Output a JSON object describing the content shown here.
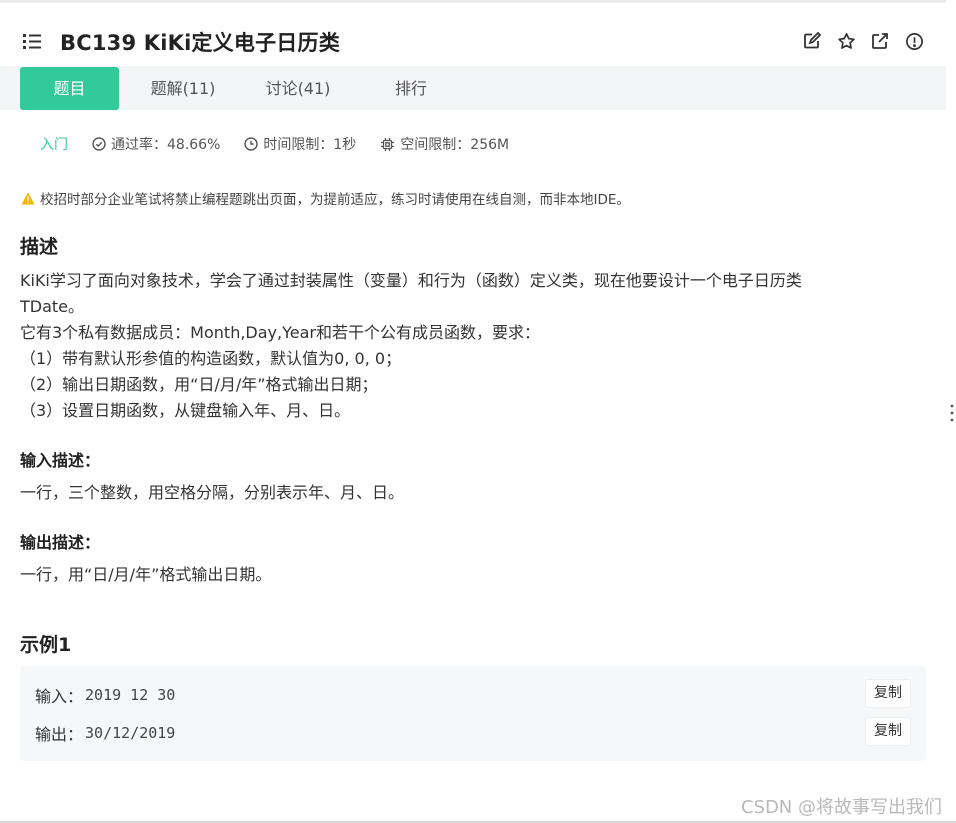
{
  "header": {
    "title": "BC139  KiKi定义电子日历类",
    "icons": [
      "list-icon",
      "edit-icon",
      "star-icon",
      "share-icon",
      "report-icon"
    ]
  },
  "tabs": [
    {
      "label": "题目",
      "active": true
    },
    {
      "label": "题解(11)",
      "active": false
    },
    {
      "label": "讨论(41)",
      "active": false
    },
    {
      "label": "排行",
      "active": false
    }
  ],
  "meta": {
    "level": "入门",
    "pass_rate": "通过率：48.66%",
    "time_limit": "时间限制：1秒",
    "memory_limit": "空间限制：256M"
  },
  "notice": "校招时部分企业笔试将禁止编程题跳出页面，为提前适应，练习时请使用在线自测，而非本地IDE。",
  "description": {
    "heading": "描述",
    "lines": [
      "KiKi学习了面向对象技术，学会了通过封装属性（变量）和行为（函数）定义类，现在他要设计一个电子日历类",
      "TDate。",
      "它有3个私有数据成员：Month,Day,Year和若干个公有成员函数，要求：",
      "（1）带有默认形参值的构造函数，默认值为0, 0, 0；",
      "（2）输出日期函数，用“日/月/年”格式输出日期；",
      "（3）设置日期函数，从键盘输入年、月、日。"
    ]
  },
  "input_desc": {
    "heading": "输入描述：",
    "text": "一行，三个整数，用空格分隔，分别表示年、月、日。"
  },
  "output_desc": {
    "heading": "输出描述：",
    "text": "一行，用“日/月/年”格式输出日期。"
  },
  "example": {
    "heading": "示例1",
    "input_label": "输入：",
    "input_value": "2019 12 30",
    "output_label": "输出：",
    "output_value": "30/12/2019",
    "copy_label": "复制"
  },
  "watermark": "CSDN @将故事写出我们",
  "colors": {
    "accent": "#32ca99",
    "warning": "#f5b400",
    "tabbar_bg": "#f4f5f7",
    "example_bg": "#f6f7f9"
  }
}
